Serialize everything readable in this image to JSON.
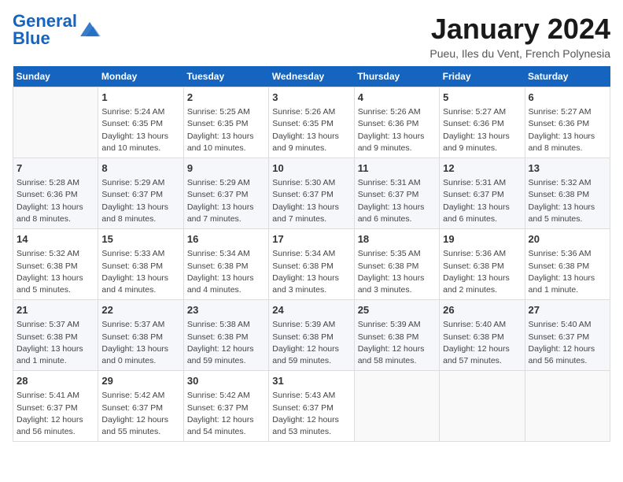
{
  "header": {
    "logo_general": "General",
    "logo_blue": "Blue",
    "month_title": "January 2024",
    "location": "Pueu, Iles du Vent, French Polynesia"
  },
  "days_of_week": [
    "Sunday",
    "Monday",
    "Tuesday",
    "Wednesday",
    "Thursday",
    "Friday",
    "Saturday"
  ],
  "weeks": [
    [
      {
        "day": "",
        "info": ""
      },
      {
        "day": "1",
        "info": "Sunrise: 5:24 AM\nSunset: 6:35 PM\nDaylight: 13 hours\nand 10 minutes."
      },
      {
        "day": "2",
        "info": "Sunrise: 5:25 AM\nSunset: 6:35 PM\nDaylight: 13 hours\nand 10 minutes."
      },
      {
        "day": "3",
        "info": "Sunrise: 5:26 AM\nSunset: 6:35 PM\nDaylight: 13 hours\nand 9 minutes."
      },
      {
        "day": "4",
        "info": "Sunrise: 5:26 AM\nSunset: 6:36 PM\nDaylight: 13 hours\nand 9 minutes."
      },
      {
        "day": "5",
        "info": "Sunrise: 5:27 AM\nSunset: 6:36 PM\nDaylight: 13 hours\nand 9 minutes."
      },
      {
        "day": "6",
        "info": "Sunrise: 5:27 AM\nSunset: 6:36 PM\nDaylight: 13 hours\nand 8 minutes."
      }
    ],
    [
      {
        "day": "7",
        "info": "Sunrise: 5:28 AM\nSunset: 6:36 PM\nDaylight: 13 hours\nand 8 minutes."
      },
      {
        "day": "8",
        "info": "Sunrise: 5:29 AM\nSunset: 6:37 PM\nDaylight: 13 hours\nand 8 minutes."
      },
      {
        "day": "9",
        "info": "Sunrise: 5:29 AM\nSunset: 6:37 PM\nDaylight: 13 hours\nand 7 minutes."
      },
      {
        "day": "10",
        "info": "Sunrise: 5:30 AM\nSunset: 6:37 PM\nDaylight: 13 hours\nand 7 minutes."
      },
      {
        "day": "11",
        "info": "Sunrise: 5:31 AM\nSunset: 6:37 PM\nDaylight: 13 hours\nand 6 minutes."
      },
      {
        "day": "12",
        "info": "Sunrise: 5:31 AM\nSunset: 6:37 PM\nDaylight: 13 hours\nand 6 minutes."
      },
      {
        "day": "13",
        "info": "Sunrise: 5:32 AM\nSunset: 6:38 PM\nDaylight: 13 hours\nand 5 minutes."
      }
    ],
    [
      {
        "day": "14",
        "info": "Sunrise: 5:32 AM\nSunset: 6:38 PM\nDaylight: 13 hours\nand 5 minutes."
      },
      {
        "day": "15",
        "info": "Sunrise: 5:33 AM\nSunset: 6:38 PM\nDaylight: 13 hours\nand 4 minutes."
      },
      {
        "day": "16",
        "info": "Sunrise: 5:34 AM\nSunset: 6:38 PM\nDaylight: 13 hours\nand 4 minutes."
      },
      {
        "day": "17",
        "info": "Sunrise: 5:34 AM\nSunset: 6:38 PM\nDaylight: 13 hours\nand 3 minutes."
      },
      {
        "day": "18",
        "info": "Sunrise: 5:35 AM\nSunset: 6:38 PM\nDaylight: 13 hours\nand 3 minutes."
      },
      {
        "day": "19",
        "info": "Sunrise: 5:36 AM\nSunset: 6:38 PM\nDaylight: 13 hours\nand 2 minutes."
      },
      {
        "day": "20",
        "info": "Sunrise: 5:36 AM\nSunset: 6:38 PM\nDaylight: 13 hours\nand 1 minute."
      }
    ],
    [
      {
        "day": "21",
        "info": "Sunrise: 5:37 AM\nSunset: 6:38 PM\nDaylight: 13 hours\nand 1 minute."
      },
      {
        "day": "22",
        "info": "Sunrise: 5:37 AM\nSunset: 6:38 PM\nDaylight: 13 hours\nand 0 minutes."
      },
      {
        "day": "23",
        "info": "Sunrise: 5:38 AM\nSunset: 6:38 PM\nDaylight: 12 hours\nand 59 minutes."
      },
      {
        "day": "24",
        "info": "Sunrise: 5:39 AM\nSunset: 6:38 PM\nDaylight: 12 hours\nand 59 minutes."
      },
      {
        "day": "25",
        "info": "Sunrise: 5:39 AM\nSunset: 6:38 PM\nDaylight: 12 hours\nand 58 minutes."
      },
      {
        "day": "26",
        "info": "Sunrise: 5:40 AM\nSunset: 6:38 PM\nDaylight: 12 hours\nand 57 minutes."
      },
      {
        "day": "27",
        "info": "Sunrise: 5:40 AM\nSunset: 6:37 PM\nDaylight: 12 hours\nand 56 minutes."
      }
    ],
    [
      {
        "day": "28",
        "info": "Sunrise: 5:41 AM\nSunset: 6:37 PM\nDaylight: 12 hours\nand 56 minutes."
      },
      {
        "day": "29",
        "info": "Sunrise: 5:42 AM\nSunset: 6:37 PM\nDaylight: 12 hours\nand 55 minutes."
      },
      {
        "day": "30",
        "info": "Sunrise: 5:42 AM\nSunset: 6:37 PM\nDaylight: 12 hours\nand 54 minutes."
      },
      {
        "day": "31",
        "info": "Sunrise: 5:43 AM\nSunset: 6:37 PM\nDaylight: 12 hours\nand 53 minutes."
      },
      {
        "day": "",
        "info": ""
      },
      {
        "day": "",
        "info": ""
      },
      {
        "day": "",
        "info": ""
      }
    ]
  ]
}
